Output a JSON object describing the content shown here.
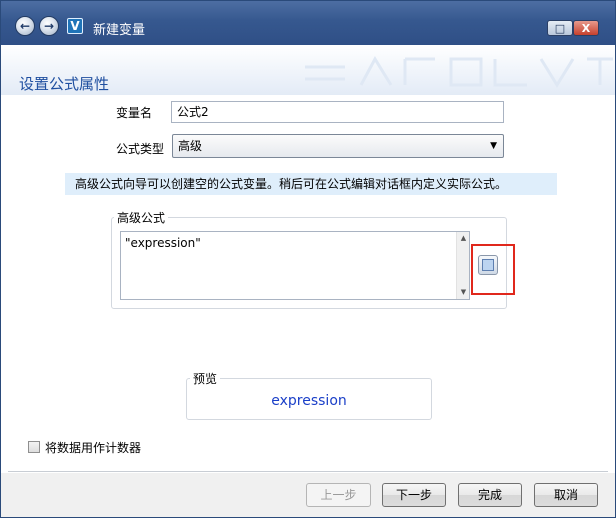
{
  "window": {
    "title": "新建变量",
    "app_logo_letter": "V",
    "nav_back_glyph": "←",
    "nav_forward_glyph": "→",
    "maximize_glyph": "□",
    "close_glyph": "X"
  },
  "page": {
    "title": "设置公式属性"
  },
  "form": {
    "variable_name_label": "变量名",
    "variable_name_value": "公式2",
    "formula_type_label": "公式类型",
    "formula_type_value": "高级"
  },
  "info": {
    "text": "高级公式向导可以创建空的公式变量。稍后可在公式编辑对话框内定义实际公式。"
  },
  "advanced": {
    "group_label": "高级公式",
    "formula_text": "\"expression\""
  },
  "preview": {
    "group_label": "预览",
    "value": "expression"
  },
  "options": {
    "use_as_counter_label": "将数据用作计数器",
    "use_as_counter_checked": false
  },
  "footer": {
    "prev_label": "上一步",
    "next_label": "下一步",
    "finish_label": "完成",
    "cancel_label": "取消"
  },
  "colors": {
    "titlebar": "#36588f",
    "page_title": "#1f4fa0",
    "info_bar": "#dfeefb",
    "preview_value": "#1a3fc8",
    "highlight": "#e0281c"
  },
  "icons": [
    "back-arrow-icon",
    "forward-arrow-icon",
    "app-logo-icon",
    "maximize-icon",
    "close-icon",
    "formula-editor-icon",
    "dropdown-arrow-icon",
    "scroll-up-icon",
    "scroll-down-icon"
  ]
}
